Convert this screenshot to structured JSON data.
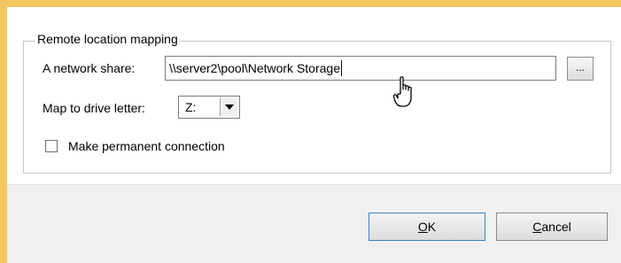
{
  "group": {
    "title": "Remote location mapping"
  },
  "network_share": {
    "label": "A network share:",
    "value": "\\\\server2\\pool\\Network Storage",
    "browse_label": "..."
  },
  "drive": {
    "label": "Map to drive letter:",
    "selected": "Z:"
  },
  "permanent": {
    "label": "Make permanent connection",
    "checked": false
  },
  "buttons": {
    "ok": {
      "accel": "O",
      "rest": "K"
    },
    "cancel": {
      "accel": "C",
      "rest": "ancel"
    }
  },
  "colors": {
    "frame": "#f0c761",
    "footer": "#f0f0f0",
    "default_button_border": "#3f7fbf"
  },
  "cursor": {
    "icon": "hand-pointer-icon"
  }
}
